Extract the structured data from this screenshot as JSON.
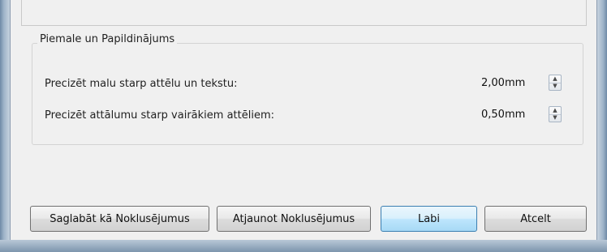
{
  "group": {
    "title": "Piemale un Papildinājums"
  },
  "rows": [
    {
      "label": "Precizēt malu starp attēlu un tekstu:",
      "value": "2,00mm"
    },
    {
      "label": "Precizēt attālumu starp vairākiem attēliem:",
      "value": "0,50mm"
    }
  ],
  "buttons": {
    "save_default": "Saglabāt kā Noklusējumus",
    "restore_default": "Atjaunot Noklusējumus",
    "ok": "Labi",
    "cancel": "Atcelt"
  },
  "icons": {
    "spin_up": "chevron-up-icon",
    "spin_down": "chevron-down-icon"
  }
}
